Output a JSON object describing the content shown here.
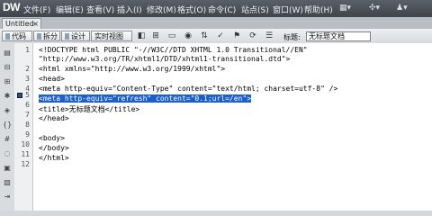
{
  "app": {
    "logo": "DW"
  },
  "menu": [
    {
      "label": "文件(F)"
    },
    {
      "label": "编辑(E)"
    },
    {
      "label": "查看(V)"
    },
    {
      "label": "插入(I)"
    },
    {
      "label": "修改(M)"
    },
    {
      "label": "格式(O)"
    },
    {
      "label": "命令(C)"
    },
    {
      "label": "站点(S)"
    },
    {
      "label": "窗口(W)"
    },
    {
      "label": "帮助(H)"
    }
  ],
  "document": {
    "tab_label": "Untitled-1*",
    "tab_close": "×"
  },
  "toolbar": {
    "views": [
      "代码",
      "拆分",
      "设计",
      "实时视图"
    ],
    "title_label": "标题:",
    "title_value": "无标题文档"
  },
  "gutter": {
    "line_numbers": [
      "1",
      "2",
      "3",
      "4",
      "5",
      "6",
      "7",
      "8",
      "9",
      "10",
      "11",
      "12"
    ]
  },
  "code": {
    "lines": [
      "<!DOCTYPE html PUBLIC \"-//W3C//DTD XHTML 1.0 Transitional//EN\"",
      "\"http://www.w3.org/TR/xhtml1/DTD/xhtml1-transitional.dtd\">",
      "<html xmlns=\"http://www.w3.org/1999/xhtml\">",
      "<head>",
      "<meta http-equiv=\"Content-Type\" content=\"text/html; charset=utf-8\" />",
      "<meta http-equiv=\"refresh\" content=\"0.1;url=/en\">",
      "<title>无标题文档</title>",
      "</head>",
      "",
      "<body>",
      "</body>",
      "</html>",
      ""
    ]
  },
  "colors": {
    "selection": "#1b5fc9",
    "menubar": "#4a4f56"
  }
}
